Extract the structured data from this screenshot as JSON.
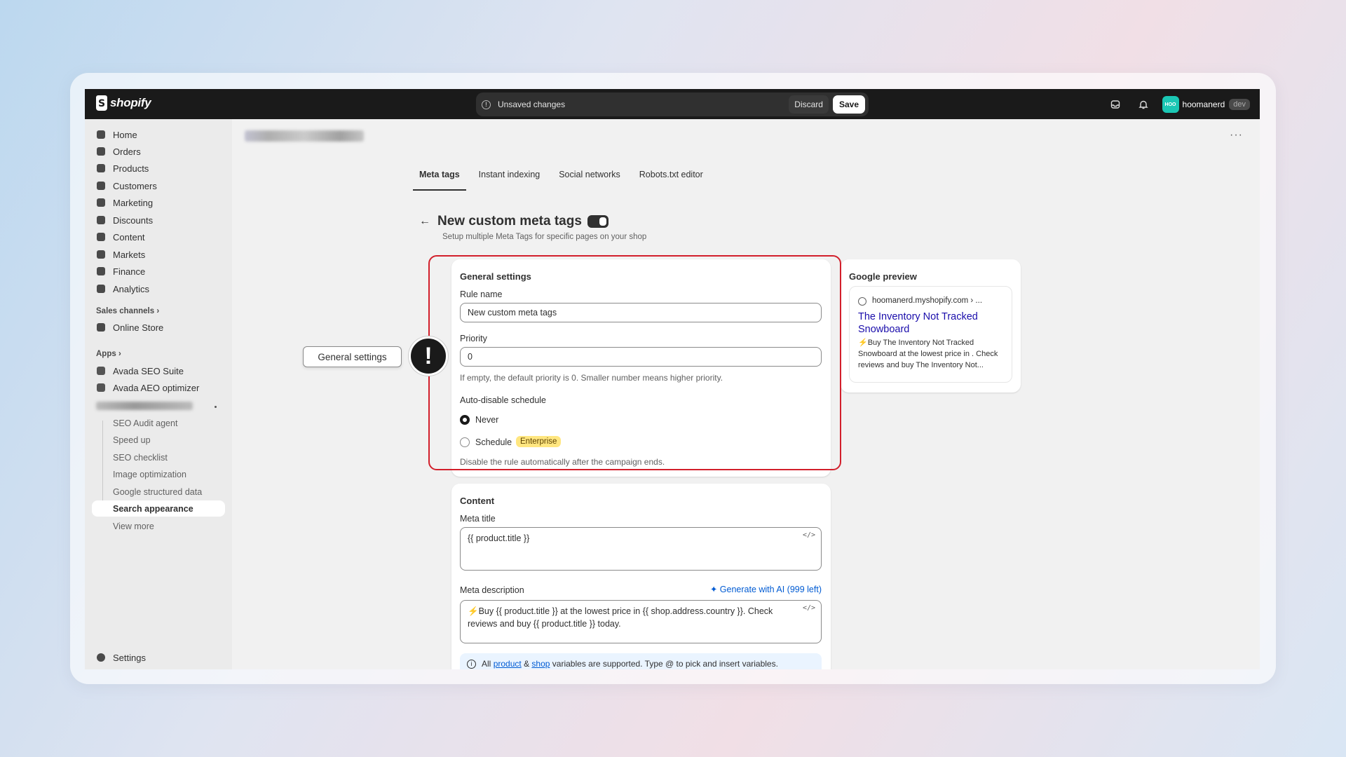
{
  "topbar": {
    "brand": "shopify",
    "unsaved_text": "Unsaved changes",
    "discard_label": "Discard",
    "save_label": "Save",
    "avatar_initials": "HOO",
    "user_name": "hoomanerd",
    "user_badge": "dev"
  },
  "sidebar": {
    "items": [
      {
        "label": "Home",
        "icon": "home-icon"
      },
      {
        "label": "Orders",
        "icon": "orders-icon"
      },
      {
        "label": "Products",
        "icon": "tag-icon"
      },
      {
        "label": "Customers",
        "icon": "person-icon"
      },
      {
        "label": "Marketing",
        "icon": "target-icon"
      },
      {
        "label": "Discounts",
        "icon": "discount-icon"
      },
      {
        "label": "Content",
        "icon": "content-icon"
      },
      {
        "label": "Markets",
        "icon": "globe-icon"
      },
      {
        "label": "Finance",
        "icon": "bank-icon"
      },
      {
        "label": "Analytics",
        "icon": "bar-chart-icon"
      }
    ],
    "sales_channels_label": "Sales channels",
    "online_store": "Online Store",
    "apps_label": "Apps",
    "apps": [
      "Avada SEO Suite",
      "Avada AEO optimizer"
    ],
    "sub_items": [
      "SEO Audit agent",
      "Speed up",
      "SEO checklist",
      "Image optimization",
      "Google structured data",
      "Search appearance",
      "View more"
    ],
    "settings": "Settings"
  },
  "tabs": [
    "Meta tags",
    "Instant indexing",
    "Social networks",
    "Robots.txt editor"
  ],
  "page": {
    "title": "New custom meta tags",
    "subtitle": "Setup multiple Meta Tags for specific pages on your shop"
  },
  "general": {
    "title": "General settings",
    "rule_name_label": "Rule name",
    "rule_name_value": "New custom meta tags",
    "priority_label": "Priority",
    "priority_value": "0",
    "priority_help": "If empty, the default priority is 0. Smaller number means higher priority.",
    "schedule_label": "Auto-disable schedule",
    "option_never": "Never",
    "option_schedule": "Schedule",
    "enterprise_badge": "Enterprise",
    "schedule_help": "Disable the rule automatically after the campaign ends."
  },
  "content": {
    "title": "Content",
    "meta_title_label": "Meta title",
    "meta_title_value": "{{ product.title }}",
    "meta_desc_label": "Meta description",
    "generate_ai": "Generate with AI (999 left)",
    "meta_desc_value": "⚡Buy {{ product.title }} at the lowest price in {{ shop.address.country }}. Check reviews and buy {{ product.title }} today.",
    "info_prefix": "All",
    "info_product": "product",
    "info_amp": "&",
    "info_shop": "shop",
    "info_suffix": "variables are supported. Type @ to pick and insert variables."
  },
  "google_preview": {
    "title": "Google preview",
    "url": "hoomanerd.myshopify.com › ...",
    "result_title": "The Inventory Not Tracked Snowboard",
    "result_desc": "⚡Buy The Inventory Not Tracked Snowboard at the lowest price in . Check reviews and buy The Inventory Not..."
  },
  "annotation": {
    "callout": "General settings",
    "marker": "!"
  },
  "colors": {
    "highlight": "#d21f2b",
    "link": "#005bd3",
    "enterprise": "#ffe680"
  }
}
